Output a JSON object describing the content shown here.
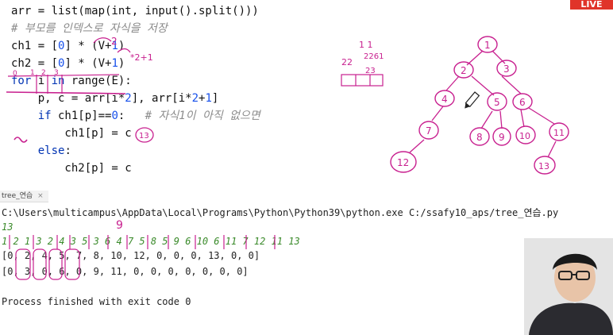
{
  "live_badge": "LIVE",
  "code_lines": [
    {
      "parts": [
        {
          "t": "arr = list(map(int, input().split()))",
          "c": ""
        }
      ]
    },
    {
      "parts": [
        {
          "t": "# 부모를 인덱스로 자식을 저장",
          "c": "cmt"
        }
      ]
    },
    {
      "parts": [
        {
          "t": "ch1 = [",
          "c": ""
        },
        {
          "t": "0",
          "c": "num"
        },
        {
          "t": "] * (V+",
          "c": ""
        },
        {
          "t": "1",
          "c": "num"
        },
        {
          "t": ")",
          "c": ""
        }
      ]
    },
    {
      "parts": [
        {
          "t": "ch2 = [",
          "c": ""
        },
        {
          "t": "0",
          "c": "num"
        },
        {
          "t": "] * (V+",
          "c": ""
        },
        {
          "t": "1",
          "c": "num"
        },
        {
          "t": ")",
          "c": ""
        }
      ]
    },
    {
      "parts": [
        {
          "t": "for",
          "c": "kw"
        },
        {
          "t": " i ",
          "c": ""
        },
        {
          "t": "in",
          "c": "kw"
        },
        {
          "t": " range(E):",
          "c": ""
        }
      ]
    },
    {
      "parts": [
        {
          "t": "    p, c = arr[i*",
          "c": ""
        },
        {
          "t": "2",
          "c": "num"
        },
        {
          "t": "], arr[i*",
          "c": ""
        },
        {
          "t": "2",
          "c": "num"
        },
        {
          "t": "+",
          "c": ""
        },
        {
          "t": "1",
          "c": "num"
        },
        {
          "t": "]",
          "c": ""
        }
      ]
    },
    {
      "parts": [
        {
          "t": "    ",
          "c": ""
        },
        {
          "t": "if",
          "c": "kw"
        },
        {
          "t": " ch1[p]==",
          "c": ""
        },
        {
          "t": "0",
          "c": "num"
        },
        {
          "t": ":   ",
          "c": ""
        },
        {
          "t": "# 자식1이 아직 없으면",
          "c": "cmt"
        }
      ]
    },
    {
      "parts": [
        {
          "t": "        ch1[p] = c",
          "c": ""
        }
      ]
    },
    {
      "parts": [
        {
          "t": "    ",
          "c": ""
        },
        {
          "t": "else",
          "c": "kw"
        },
        {
          "t": ":",
          "c": ""
        }
      ]
    },
    {
      "parts": [
        {
          "t": "        ch2[p] = c",
          "c": ""
        }
      ]
    }
  ],
  "run_tab": {
    "label": "tree_연습",
    "close_icon": "×"
  },
  "console": {
    "command": "C:\\Users\\multicampus\\AppData\\Local\\Programs\\Python\\Python39\\python.exe C:/ssafy10_aps/tree_연습.py",
    "input_line_1": "13",
    "input_line_2": "1 2 1 3 2 4 3 5 3 6 4 7 5 8 5 9 6 10 6 11 7 12 11 13",
    "output_ch1": "[0, 2, 4, 5, 7, 8, 10, 12, 0, 0, 0, 13, 0, 0]",
    "output_ch2": "[0, 3, 0, 6, 0, 9, 11, 0, 0, 0, 0, 0, 0, 0]",
    "exit_message": "Process finished with exit code 0"
  },
  "ink_annotations": {
    "over_v1": "2",
    "over_v2": "*2+1",
    "left_note": "22",
    "top_note": "1 1",
    "right_note": "2261",
    "mid_note": "23",
    "if_note": "13",
    "for_underline_digits": [
      "0",
      "1",
      "2",
      "3"
    ],
    "console_mark": "9"
  },
  "tree_nodes": [
    "1",
    "2",
    "3",
    "4",
    "5",
    "6",
    "7",
    "8",
    "9",
    "10",
    "11",
    "12",
    "13"
  ],
  "colors": {
    "ink": "#c8208f",
    "keyword": "#0033b3",
    "number": "#1750eb",
    "comment": "#8c8c8c",
    "live": "#e0342a"
  }
}
